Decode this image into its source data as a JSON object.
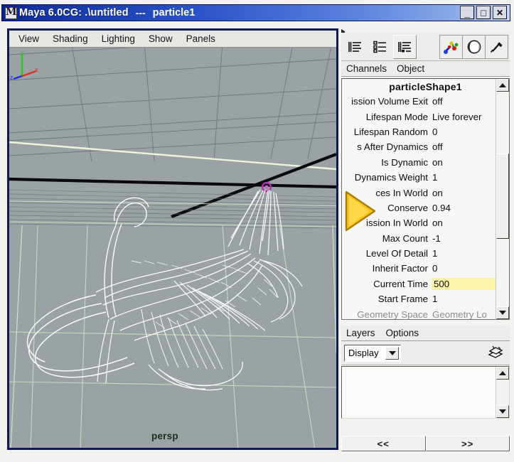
{
  "window": {
    "app_icon": "maya-logo-icon",
    "title": "Maya 6.0CG: .\\untitled",
    "title_separator": "---",
    "selected_object": "particle1",
    "controls": {
      "minimize": "_",
      "maximize": "□",
      "close": "✕"
    },
    "titlebar_color": "#12329f"
  },
  "viewport": {
    "menus": [
      {
        "label": "View"
      },
      {
        "label": "Shading"
      },
      {
        "label": "Lighting"
      },
      {
        "label": "Show"
      },
      {
        "label": "Panels"
      }
    ],
    "camera_label": "persp",
    "background_color": "#9ba2a6",
    "grid_color": "#6f7a80",
    "particle_color": "#ffffff",
    "emitter_color": "#b030b0",
    "axis_gizmo": {
      "x_label": "x",
      "x_color": "#e03020",
      "y_label": "y",
      "y_color": "#2fbf2f",
      "z_label": "z",
      "z_color": "#2030d8"
    }
  },
  "channel_box": {
    "toolbar_icons": [
      {
        "name": "channel-box-list-icon"
      },
      {
        "name": "channel-box-detail-list-icon"
      },
      {
        "name": "channel-box-outline-list-icon"
      },
      {
        "name": "paint-effects-icon"
      },
      {
        "name": "shading-sphere-icon"
      },
      {
        "name": "eyedropper-icon"
      }
    ],
    "tabs": [
      {
        "label": "Channels"
      },
      {
        "label": "Object"
      }
    ],
    "node_name": "particleShape1",
    "attributes": [
      {
        "label": "ission Volume Exit",
        "value": "off",
        "highlight": false,
        "clipped": true
      },
      {
        "label": "Lifespan Mode",
        "value": "Live forever",
        "highlight": false,
        "clipped": false
      },
      {
        "label": "Lifespan Random",
        "value": "0",
        "highlight": false,
        "clipped": false
      },
      {
        "label": "s After Dynamics",
        "value": "off",
        "highlight": false,
        "clipped": true
      },
      {
        "label": "Is Dynamic",
        "value": "on",
        "highlight": false,
        "clipped": false
      },
      {
        "label": "Dynamics Weight",
        "value": "1",
        "highlight": false,
        "clipped": false
      },
      {
        "label": "ces In World",
        "value": "on",
        "highlight": false,
        "clipped": true
      },
      {
        "label": "Conserve",
        "value": "0.94",
        "highlight": false,
        "clipped": false
      },
      {
        "label": "ission In World",
        "value": "on",
        "highlight": false,
        "clipped": true
      },
      {
        "label": "Max Count",
        "value": "-1",
        "highlight": false,
        "clipped": false
      },
      {
        "label": "Level Of Detail",
        "value": "1",
        "highlight": false,
        "clipped": false
      },
      {
        "label": "Inherit Factor",
        "value": "0",
        "highlight": false,
        "clipped": false
      },
      {
        "label": "Current Time",
        "value": "500",
        "highlight": true,
        "clipped": false
      },
      {
        "label": "Start Frame",
        "value": "1",
        "highlight": false,
        "clipped": false
      },
      {
        "label": "Geometry Space",
        "value": "Geometry Lo",
        "highlight": false,
        "clipped": true
      }
    ],
    "highlight_color": "#fbf3a8"
  },
  "layers": {
    "menus": [
      {
        "label": "Layers"
      },
      {
        "label": "Options"
      }
    ],
    "display_mode": "Display",
    "new_layer_icon": "new-layer-icon",
    "items": []
  },
  "bottom_nav": {
    "prev_label": "<<",
    "next_label": ">>"
  }
}
